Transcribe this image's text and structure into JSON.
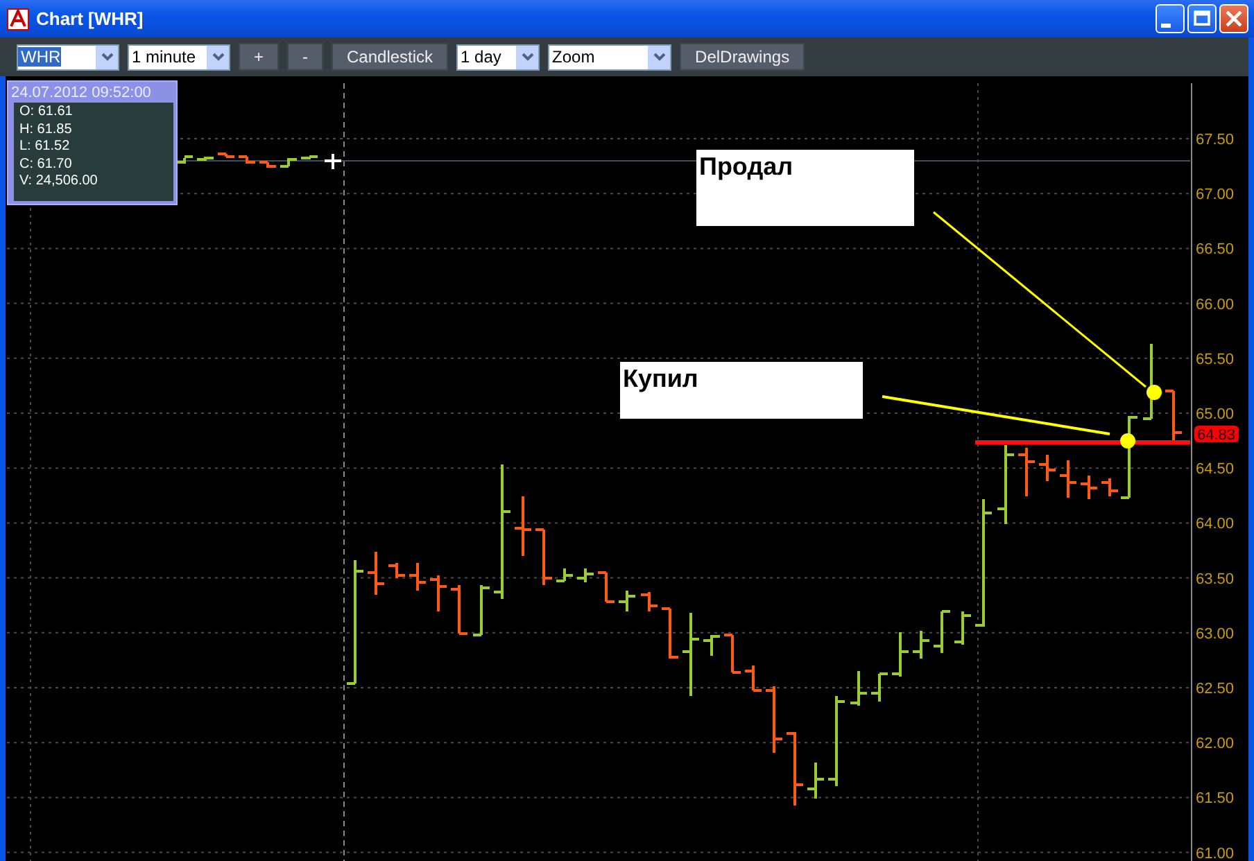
{
  "window": {
    "title": "Chart [WHR]"
  },
  "toolbar": [
    {
      "kind": "combo",
      "value": "WHR",
      "highlighted": true
    },
    {
      "kind": "combo",
      "value": "1 minute",
      "highlighted": false
    },
    {
      "kind": "button",
      "label": "+"
    },
    {
      "kind": "button",
      "label": "-"
    },
    {
      "kind": "button",
      "label": "Candlestick"
    },
    {
      "kind": "combo",
      "value": "1 day",
      "highlighted": false
    },
    {
      "kind": "combo",
      "value": "Zoom",
      "highlighted": false
    },
    {
      "kind": "button",
      "label": "DelDrawings"
    }
  ],
  "info_box": {
    "title": "24.07.2012 09:52:00",
    "lines": [
      "O: 61.61",
      "H: 61.85",
      "L: 61.52",
      "C: 61.70",
      "V: 24,506.00"
    ]
  },
  "annotations": [
    {
      "text": "Продал"
    },
    {
      "text": "Купил"
    }
  ],
  "price_axis": {
    "labels": [
      "67.50",
      "67.00",
      "66.50",
      "66.00",
      "65.50",
      "65.00",
      "64.50",
      "64.00",
      "63.50",
      "63.00",
      "62.50",
      "62.00",
      "61.50",
      "61.00"
    ],
    "current_price": "64.83"
  }
}
